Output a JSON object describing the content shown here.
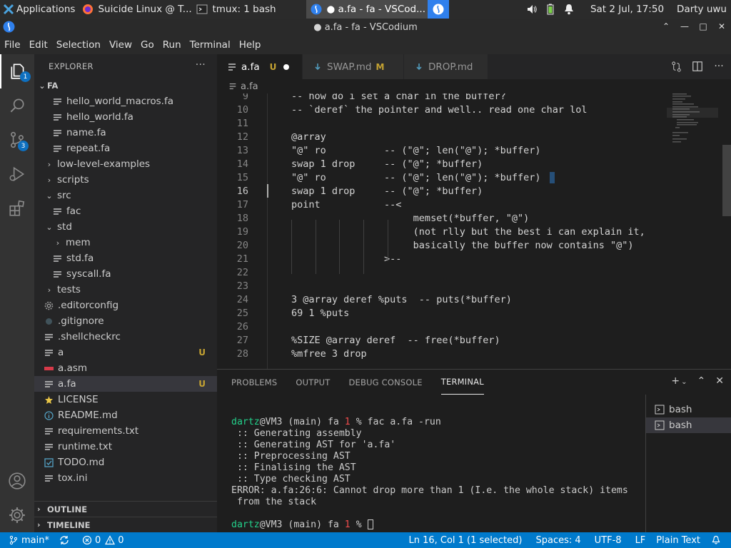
{
  "system_panel": {
    "applications_label": "Applications",
    "tasks": [
      {
        "label": "Suicide Linux @ T...",
        "icon": "firefox-icon",
        "active": false
      },
      {
        "label": "tmux: 1 bash",
        "icon": "terminal-icon",
        "active": false
      },
      {
        "label": "● a.fa - fa - VSCod...",
        "icon": "vscodium-icon",
        "active": true
      }
    ],
    "clock": "Sat  2 Jul, 17:50",
    "user": "Darty uwu"
  },
  "window": {
    "title": "● a.fa - fa - VSCodium"
  },
  "menu": [
    "File",
    "Edit",
    "Selection",
    "View",
    "Go",
    "Run",
    "Terminal",
    "Help"
  ],
  "activity_bar": {
    "explorer_badge": "1",
    "scm_badge": "3"
  },
  "explorer": {
    "header": "EXPLORER",
    "more": "···",
    "root": "FA",
    "items": [
      {
        "label": "hello_world_macros.fa",
        "indent": 2,
        "kind": "fa",
        "chev": ""
      },
      {
        "label": "hello_world.fa",
        "indent": 2,
        "kind": "fa",
        "chev": ""
      },
      {
        "label": "name.fa",
        "indent": 2,
        "kind": "fa",
        "chev": ""
      },
      {
        "label": "repeat.fa",
        "indent": 2,
        "kind": "fa",
        "chev": ""
      },
      {
        "label": "low-level-examples",
        "indent": 1,
        "kind": "folder",
        "chev": "›"
      },
      {
        "label": "scripts",
        "indent": 1,
        "kind": "folder",
        "chev": "›"
      },
      {
        "label": "src",
        "indent": 1,
        "kind": "folder",
        "chev": "⌄"
      },
      {
        "label": "fac",
        "indent": 2,
        "kind": "file",
        "chev": ""
      },
      {
        "label": "std",
        "indent": 1,
        "kind": "folder",
        "chev": "⌄"
      },
      {
        "label": "mem",
        "indent": 2,
        "kind": "folder",
        "chev": "›"
      },
      {
        "label": "std.fa",
        "indent": 2,
        "kind": "fa",
        "chev": ""
      },
      {
        "label": "syscall.fa",
        "indent": 2,
        "kind": "fa",
        "chev": ""
      },
      {
        "label": "tests",
        "indent": 1,
        "kind": "folder",
        "chev": "›"
      },
      {
        "label": ".editorconfig",
        "indent": 1,
        "kind": "gear",
        "chev": ""
      },
      {
        "label": ".gitignore",
        "indent": 1,
        "kind": "git",
        "chev": ""
      },
      {
        "label": ".shellcheckrc",
        "indent": 1,
        "kind": "file",
        "chev": ""
      },
      {
        "label": "a",
        "indent": 1,
        "kind": "file",
        "chev": "",
        "status": "U"
      },
      {
        "label": "a.asm",
        "indent": 1,
        "kind": "asm",
        "chev": ""
      },
      {
        "label": "a.fa",
        "indent": 1,
        "kind": "fa",
        "chev": "",
        "status": "U",
        "selected": true
      },
      {
        "label": "LICENSE",
        "indent": 1,
        "kind": "license",
        "chev": ""
      },
      {
        "label": "README.md",
        "indent": 1,
        "kind": "info",
        "chev": ""
      },
      {
        "label": "requirements.txt",
        "indent": 1,
        "kind": "file",
        "chev": ""
      },
      {
        "label": "runtime.txt",
        "indent": 1,
        "kind": "file",
        "chev": ""
      },
      {
        "label": "TODO.md",
        "indent": 1,
        "kind": "check",
        "chev": ""
      },
      {
        "label": "tox.ini",
        "indent": 1,
        "kind": "file",
        "chev": ""
      }
    ],
    "outline": "OUTLINE",
    "timeline": "TIMELINE"
  },
  "tabs": [
    {
      "label": "a.fa",
      "flag": "U",
      "dirty": true,
      "active": true
    },
    {
      "label": "SWAP.md",
      "flag": "M",
      "dirty": false,
      "active": false
    },
    {
      "label": "DROP.md",
      "flag": "",
      "dirty": false,
      "active": false
    }
  ],
  "breadcrumb": "a.fa",
  "code": {
    "current_line": "16",
    "lines": [
      {
        "n": "9",
        "t": "-- how do i set a char in the buffer?"
      },
      {
        "n": "10",
        "t": "-- `deref` the pointer and well.. read one char lol"
      },
      {
        "n": "11",
        "t": ""
      },
      {
        "n": "12",
        "t": "@array"
      },
      {
        "n": "13",
        "t": "\"@\" ro          -- (\"@\"; len(\"@\"); *buffer)"
      },
      {
        "n": "14",
        "t": "swap 1 drop     -- (\"@\"; *buffer)"
      },
      {
        "n": "15",
        "t": "\"@\" ro          -- (\"@\"; len(\"@\"); *buffer)"
      },
      {
        "n": "16",
        "t": "swap 1 drop     -- (\"@\"; *buffer)"
      },
      {
        "n": "17",
        "t": "point           --<"
      },
      {
        "n": "18",
        "t": "                     memset(*buffer, \"@\")"
      },
      {
        "n": "19",
        "t": "                     (not rlly but the best i can explain it,"
      },
      {
        "n": "20",
        "t": "                     basically the buffer now contains \"@\")"
      },
      {
        "n": "21",
        "t": "                >--"
      },
      {
        "n": "22",
        "t": ""
      },
      {
        "n": "23",
        "t": ""
      },
      {
        "n": "24",
        "t": "3 @array deref %puts  -- puts(*buffer)"
      },
      {
        "n": "25",
        "t": "69 1 %puts"
      },
      {
        "n": "26",
        "t": ""
      },
      {
        "n": "27",
        "t": "%SIZE @array deref  -- free(*buffer)"
      },
      {
        "n": "28",
        "t": "%mfree 3 drop"
      }
    ]
  },
  "panel": {
    "tabs": [
      "PROBLEMS",
      "OUTPUT",
      "DEBUG CONSOLE",
      "TERMINAL"
    ],
    "active_tab": "TERMINAL",
    "terminal": {
      "prompt_user": "dartz",
      "prompt_rest": "@VM3 (main) fa ",
      "prompt_code": "1",
      "prompt_pct": " % ",
      "command": "fac a.fa -run",
      "output": [
        " :: Generating assembly",
        " :: Generating AST for 'a.fa'",
        " :: Preprocessing AST",
        " :: Finalising the AST",
        " :: Type checking AST",
        "ERROR: a.fa:26:6: Cannot drop more than 1 (I.e. the whole stack) items",
        " from the stack"
      ]
    },
    "terminals": [
      "bash",
      "bash"
    ]
  },
  "status": {
    "branch": "main*",
    "errors": "0",
    "warnings": "0",
    "position": "Ln 16, Col 1 (1 selected)",
    "spaces": "Spaces: 4",
    "encoding": "UTF-8",
    "eol": "LF",
    "language": "Plain Text"
  },
  "colors": {
    "status_bar": "#007acc",
    "badge": "#0e70c0",
    "untracked": "#c5a332",
    "prompt_user": "#23d18b",
    "prompt_code": "#f14c4c"
  }
}
